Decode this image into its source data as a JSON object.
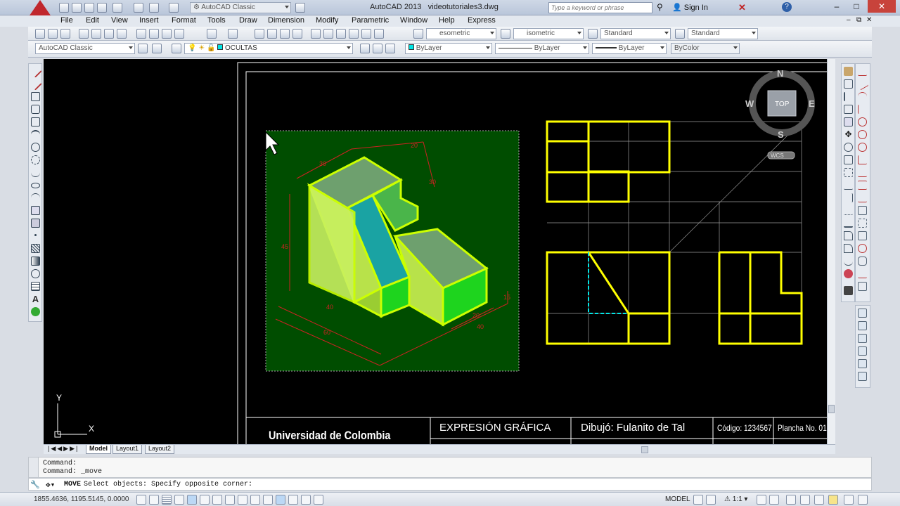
{
  "window": {
    "title_app": "AutoCAD 2013",
    "title_file": "videotutoriales3.dwg",
    "workspace": "AutoCAD Classic",
    "search_placeholder": "Type a keyword or phrase",
    "sign_in": "Sign In"
  },
  "menu": [
    "File",
    "Edit",
    "View",
    "Insert",
    "Format",
    "Tools",
    "Draw",
    "Dimension",
    "Modify",
    "Parametric",
    "Window",
    "Help",
    "Express"
  ],
  "toolbar": {
    "text_style": "esometric",
    "dim_style": "isometric",
    "table_style": "Standard",
    "multileader_style": "Standard",
    "workspace2": "AutoCAD Classic",
    "layer": "OCULTAS",
    "color": "ByLayer",
    "linetype": "ByLayer",
    "lineweight": "ByLayer",
    "plotstyle": "ByColor"
  },
  "viewcube": {
    "north": "N",
    "south": "S",
    "east": "E",
    "west": "W",
    "face": "TOP",
    "wcs": "WCS"
  },
  "ucs": {
    "y_label": "Y",
    "x_label": "X"
  },
  "drawing": {
    "dims": [
      "30",
      "20",
      "30",
      "45",
      "40",
      "60",
      "15",
      "20",
      "40"
    ]
  },
  "title_block": {
    "university": "Universidad de Colombia",
    "course": "EXPRESIÓN GRÁFICA",
    "drawn_by": "Dibujó: Fulanito de Tal",
    "code": "Código: 1234567",
    "sheet": "Plancha No. 01"
  },
  "tabs": [
    "Model",
    "Layout1",
    "Layout2"
  ],
  "command": {
    "line1": "Command:",
    "line2": "Command: _move",
    "prompt_cmd": "MOVE",
    "prompt_text": "Select objects: Specify opposite corner:"
  },
  "status": {
    "coords": "1855.4636, 1195.5145, 0.0000",
    "space": "MODEL",
    "scale": "1:1"
  },
  "colors": {
    "canvas": "#000000",
    "yellow": "#ffff00",
    "green_fill": "#004d00",
    "cyan": "#00e5e5"
  }
}
